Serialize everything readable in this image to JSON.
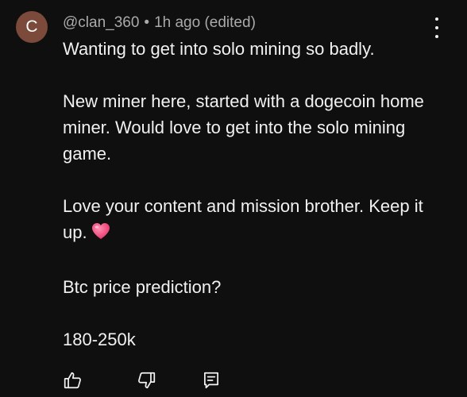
{
  "author": {
    "avatar_letter": "C",
    "avatar_color": "#7b4a3a",
    "handle": "@clan_360",
    "separator": "•",
    "time": "1h ago (edited)"
  },
  "comment": {
    "p1": "Wanting to get into solo mining so badly.",
    "p2": "New miner here, started with a dogecoin home miner. Would love to get into the solo mining game.",
    "p3": "Love your content and mission brother. Keep it up.",
    "p3_emoji": "heart-emoji",
    "p4": "Btc price prediction?",
    "p5": "180-250k"
  },
  "actions": {
    "like_icon": "thumbs-up-icon",
    "dislike_icon": "thumbs-down-icon",
    "reply_icon": "reply-icon",
    "more_icon": "more-vertical-icon"
  }
}
